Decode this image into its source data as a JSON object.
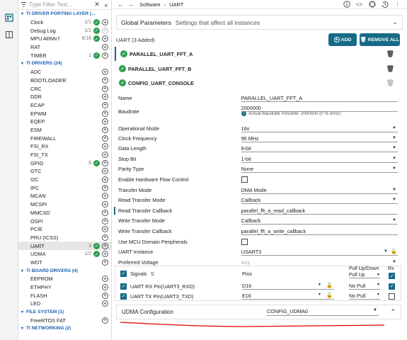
{
  "sidebar_icons": [
    "device-icon",
    "book-icon"
  ],
  "filter": {
    "placeholder": "Type Filter Text..."
  },
  "tree": {
    "cat_porting": "TI DRIVER PORTING LAYER (...",
    "porting": [
      {
        "name": "Clock",
        "count": "1/1",
        "status": "ok"
      },
      {
        "name": "Debug Log",
        "count": "1/1",
        "status": "ok",
        "disabled": true
      },
      {
        "name": "MPU ARMv7",
        "count": "6/16",
        "status": "ok"
      },
      {
        "name": "RAT",
        "count": "",
        "status": ""
      },
      {
        "name": "TIMER",
        "count": "1",
        "status": "ok"
      }
    ],
    "cat_drivers": "TI DRIVERS (24)",
    "drivers": [
      {
        "name": "ADC"
      },
      {
        "name": "BOOTLOADER"
      },
      {
        "name": "CRC"
      },
      {
        "name": "DDR"
      },
      {
        "name": "ECAP"
      },
      {
        "name": "EPWM"
      },
      {
        "name": "EQEP"
      },
      {
        "name": "ESM"
      },
      {
        "name": "FIREWALL"
      },
      {
        "name": "FSI_RX"
      },
      {
        "name": "FSI_TX"
      },
      {
        "name": "GPIO",
        "count": "8",
        "status": "ok"
      },
      {
        "name": "GTC"
      },
      {
        "name": "I2C"
      },
      {
        "name": "IPC"
      },
      {
        "name": "MCAN"
      },
      {
        "name": "MCSPI"
      },
      {
        "name": "MMCSD"
      },
      {
        "name": "OSPI"
      },
      {
        "name": "PCIE"
      },
      {
        "name": "PRU (ICSS)"
      },
      {
        "name": "UART",
        "count": "3",
        "status": "ok",
        "selected": true
      },
      {
        "name": "UDMA",
        "count": "1/2",
        "status": "ok"
      },
      {
        "name": "WDT"
      }
    ],
    "cat_board": "TI BOARD DRIVERS (4)",
    "board": [
      {
        "name": "EEPROM"
      },
      {
        "name": "ETHPHY"
      },
      {
        "name": "FLASH"
      },
      {
        "name": "LED"
      }
    ],
    "cat_fs": "FILE SYSTEM (1)",
    "fs": [
      {
        "name": "FreeRTOS FAT"
      }
    ],
    "cat_net": "TI NETWORKING (2)"
  },
  "topbar": {
    "crumb1": "Software",
    "crumb2": "UART"
  },
  "global": {
    "title": "Global Parameters",
    "subtitle": "Settings that affect all instances"
  },
  "uart_header": "UART (3 Added)",
  "buttons": {
    "add": "ADD",
    "remove_all": "REMOVE ALL"
  },
  "instances": [
    "PARALLEL_UART_FFT_A",
    "PARALLEL_UART_FFT_B",
    "CONFIG_UART_CONSOLE"
  ],
  "props": {
    "name": {
      "label": "Name",
      "value": "PARALLEL_UART_FFT_A"
    },
    "baud": {
      "label": "Baudrate",
      "value": "2000000",
      "note": "Actual Baudrate Possible: 2000000 (0 % error)"
    },
    "opmode": {
      "label": "Operational Mode",
      "value": "16x"
    },
    "clock": {
      "label": "Clock Frequency",
      "value": "96 MHz"
    },
    "datalen": {
      "label": "Data Length",
      "value": "8-bit"
    },
    "stop": {
      "label": "Stop Bit",
      "value": "1-bit"
    },
    "parity": {
      "label": "Parity Type",
      "value": "None"
    },
    "hwflow": {
      "label": "Enable Hardware Flow Control"
    },
    "txmode": {
      "label": "Transfer Mode",
      "value": "DMA Mode"
    },
    "rtmode": {
      "label": "Read Transfer Mode",
      "value": "Callback"
    },
    "rtcb": {
      "label": "Read Transfer Callback",
      "value": "parallel_fft_a_read_callback"
    },
    "wtmode": {
      "label": "Write Transfer Mode",
      "value": "Callback"
    },
    "wtcb": {
      "label": "Write Transfer Callback",
      "value": "parallel_fft_a_write_callback"
    },
    "mcu": {
      "label": "Use MCU Domain Peripherals"
    },
    "inst": {
      "label": "UART Instance",
      "value": "USART3"
    },
    "pv": {
      "label": "Preferred Voltage",
      "value": "Any"
    }
  },
  "signals": {
    "h_signals": "Signals",
    "h_pins": "Pins",
    "h_pull": "Pull Up/Down",
    "h_rx": "Rx",
    "all_pull": "Pull Up",
    "rows": [
      {
        "name": "UART RX Pin(UART3_RXD)",
        "pin": "D16",
        "pull": "No Pull",
        "rx": true
      },
      {
        "name": "UART TX Pin(UART3_TXD)",
        "pin": "E16",
        "pull": "No Pull",
        "rx": false
      }
    ]
  },
  "udma": {
    "label": "UDMA Configuration",
    "value": "CONFIG_UDMA0"
  },
  "colors": {
    "accent": "#176b87",
    "ok": "#2e9d4f",
    "annotation": "#e00000"
  }
}
